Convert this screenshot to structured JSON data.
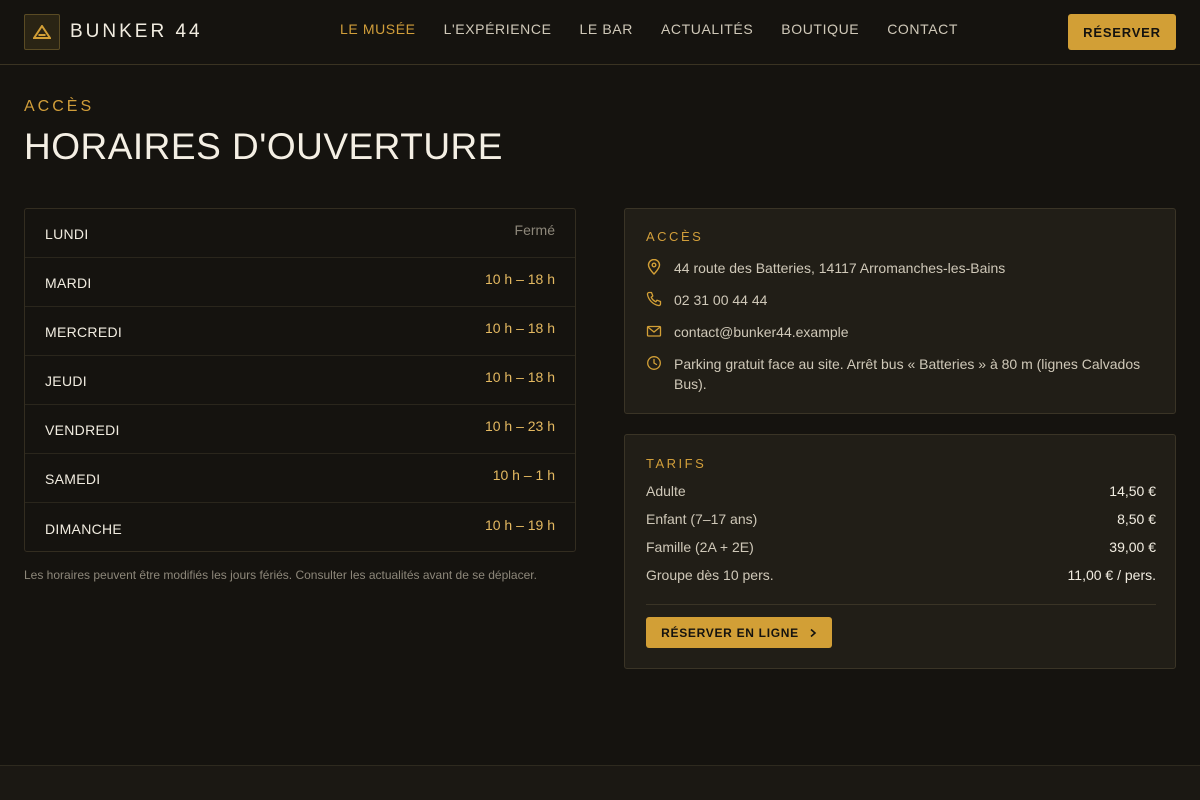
{
  "brand": {
    "name": "BUNKER 44",
    "logo_icon": "triangle-logo-icon"
  },
  "nav": {
    "items": [
      {
        "label": "LE MUSÉE",
        "active": true
      },
      {
        "label": "L'EXPÉRIENCE",
        "active": false
      },
      {
        "label": "LE BAR",
        "active": false
      },
      {
        "label": "ACTUALITÉS",
        "active": false
      },
      {
        "label": "BOUTIQUE",
        "active": false
      },
      {
        "label": "CONTACT",
        "active": false
      }
    ],
    "reserve_label": "RÉSERVER"
  },
  "hero": {
    "eyebrow": "ACCÈS",
    "title": "HORAIRES D'OUVERTURE"
  },
  "hours": {
    "rows": [
      {
        "day": "LUNDI",
        "time": "Fermé",
        "closed": true
      },
      {
        "day": "MARDI",
        "time": "10 h – 18 h"
      },
      {
        "day": "MERCREDI",
        "time": "10 h – 18 h"
      },
      {
        "day": "JEUDI",
        "time": "10 h – 18 h"
      },
      {
        "day": "VENDREDI",
        "time": "10 h – 23 h"
      },
      {
        "day": "SAMEDI",
        "time": "10 h – 1 h"
      },
      {
        "day": "DIMANCHE",
        "time": "10 h – 19 h"
      }
    ],
    "note": "Les horaires peuvent être modifiés les jours fériés. Consulter les actualités avant de se déplacer."
  },
  "access": {
    "label": "ACCÈS",
    "address": "44 route des Batteries, 14117 Arromanches-les-Bains",
    "phone": "02 31 00 44 44",
    "email": "contact@bunker44.example",
    "transport": "Parking gratuit face au site. Arrêt bus « Batteries » à 80 m (lignes Calvados Bus)."
  },
  "tarifs": {
    "label": "TARIFS",
    "rows": [
      {
        "name": "Adulte",
        "price": "14,50 €"
      },
      {
        "name": "Enfant (7–17 ans)",
        "price": "8,50 €"
      },
      {
        "name": "Famille (2A + 2E)",
        "price": "39,00 €"
      },
      {
        "name": "Groupe dès 10 pers.",
        "price": "11,00 € / pers."
      }
    ],
    "cta_label": "RÉSERVER EN LIGNE"
  },
  "colors": {
    "accent": "#d29f36",
    "background": "#15130f",
    "card": "#211e17"
  }
}
